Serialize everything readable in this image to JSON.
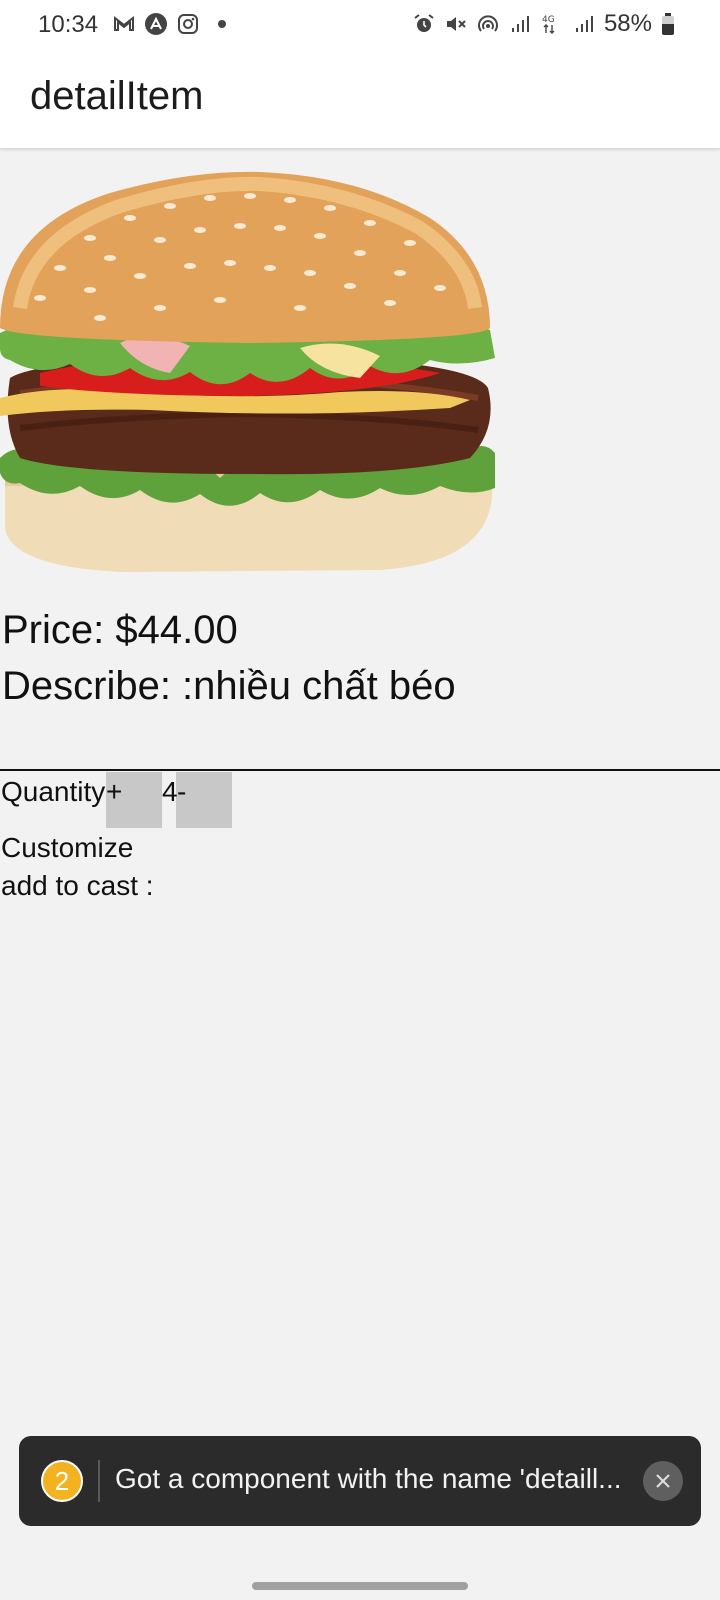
{
  "status_bar": {
    "time": "10:34",
    "left_icons": [
      "gmail-icon",
      "app-a-icon",
      "instagram-icon",
      "notification-dot-icon"
    ],
    "right_icons": [
      "alarm-icon",
      "mute-icon",
      "hotspot-icon",
      "signal-icon",
      "4g-signal-icon",
      "signal-icon-2"
    ],
    "battery": "58%",
    "battery_level": 0.58
  },
  "app_bar": {
    "title": "detailItem"
  },
  "product": {
    "image_icon": "burger-image",
    "price": "Price: $44.00",
    "describe": "Describe:  :nhiều chất béo"
  },
  "quantity": {
    "label": "Quantity",
    "plus": "+",
    "value": "4",
    "minus": "-"
  },
  "customize_label": "Customize",
  "add_to_cart_label": "add to cast :",
  "toast": {
    "badge": "2",
    "message": "Got a component with the name 'detaill..."
  }
}
